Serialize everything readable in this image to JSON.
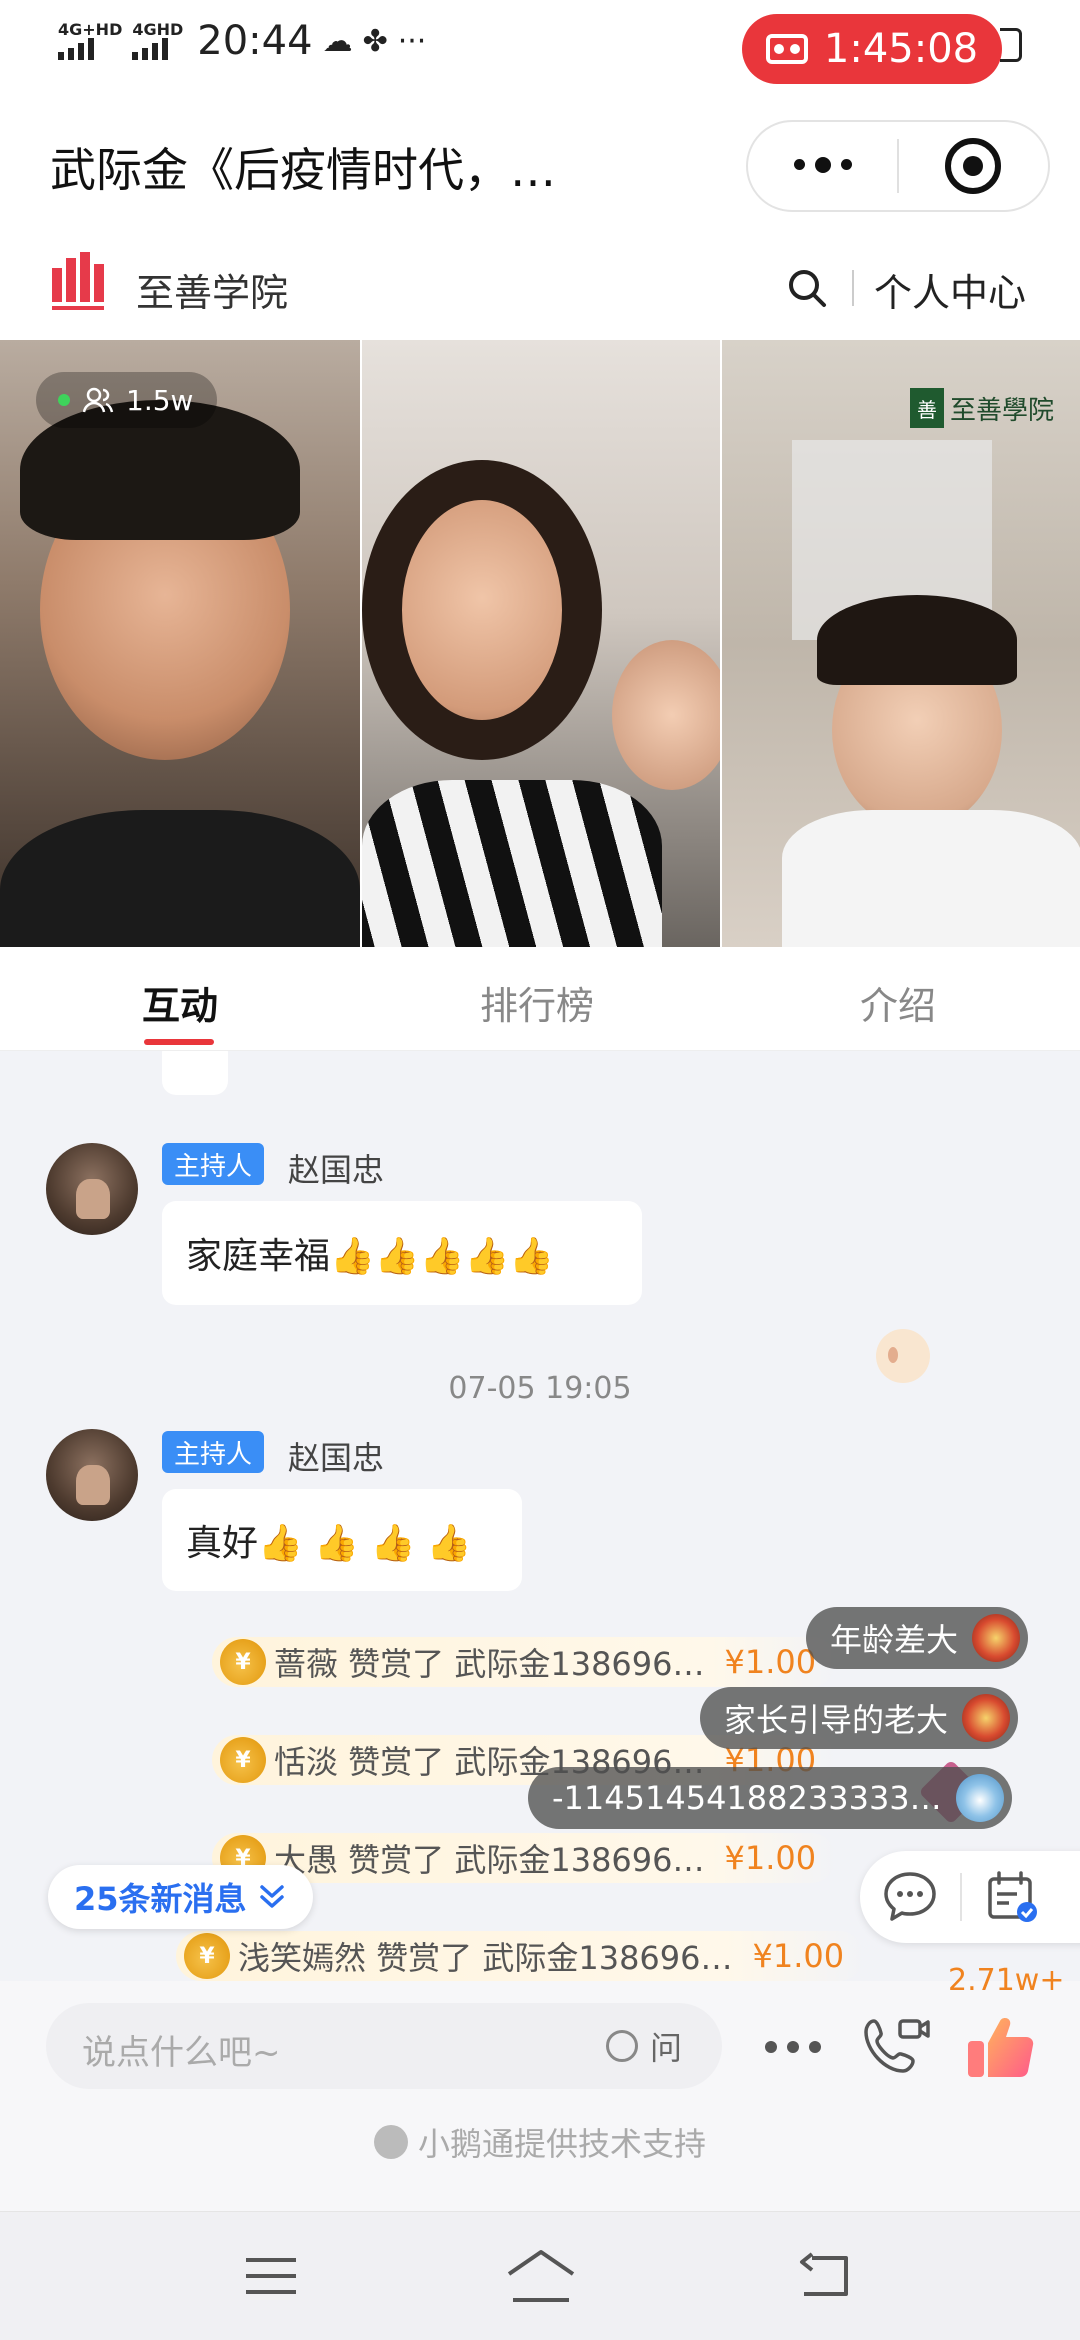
{
  "status_bar": {
    "sim1": "4G+HD",
    "sim2": "4GHD",
    "time": "20:44",
    "more": "···",
    "recording_timer": "1:45:08",
    "recording_color": "#e9363b"
  },
  "title_bar": {
    "title": "武际金《后疫情时代，…"
  },
  "brand": {
    "name": "至善学院",
    "personal_center": "个人中心"
  },
  "video": {
    "viewer_count": "1.5w",
    "watermark": "至善學院",
    "watermark_mark": "善"
  },
  "tabs": [
    {
      "label": "互动",
      "active": true
    },
    {
      "label": "排行榜",
      "active": false
    },
    {
      "label": "介绍",
      "active": false
    }
  ],
  "chat": {
    "messages": [
      {
        "role": "主持人",
        "sender": "赵国忠",
        "text": "家庭幸福👍👍👍👍👍"
      },
      {
        "role": "主持人",
        "sender": "赵国忠",
        "text": "真好👍 👍 👍 👍"
      }
    ],
    "timestamp": "07-05 19:05",
    "tips": [
      {
        "text": "蔷薇 赞赏了 武际金138696…",
        "amount": "¥1.00"
      },
      {
        "text": "恬淡 赞赏了 武际金138696…",
        "amount": "¥1.00"
      },
      {
        "text": "大愚 赞赏了 武际金138696…",
        "amount": "¥1.00"
      },
      {
        "text": "浅笑嫣然 赞赏了 武际金138696…",
        "amount": "¥1.00"
      }
    ],
    "bag_glyph": "¥",
    "danmu": [
      {
        "text": "年龄差大"
      },
      {
        "text": "家长引导的老大"
      },
      {
        "text": "-11451454188233333…"
      }
    ],
    "new_messages": "25条新消息",
    "accent_blue": "#2a6ff0",
    "amount_color": "#f0831f"
  },
  "input": {
    "placeholder": "说点什么吧~",
    "ask_label": "问",
    "like_count": "2.71w+"
  },
  "footer": {
    "support": "小鹅通提供技术支持"
  }
}
